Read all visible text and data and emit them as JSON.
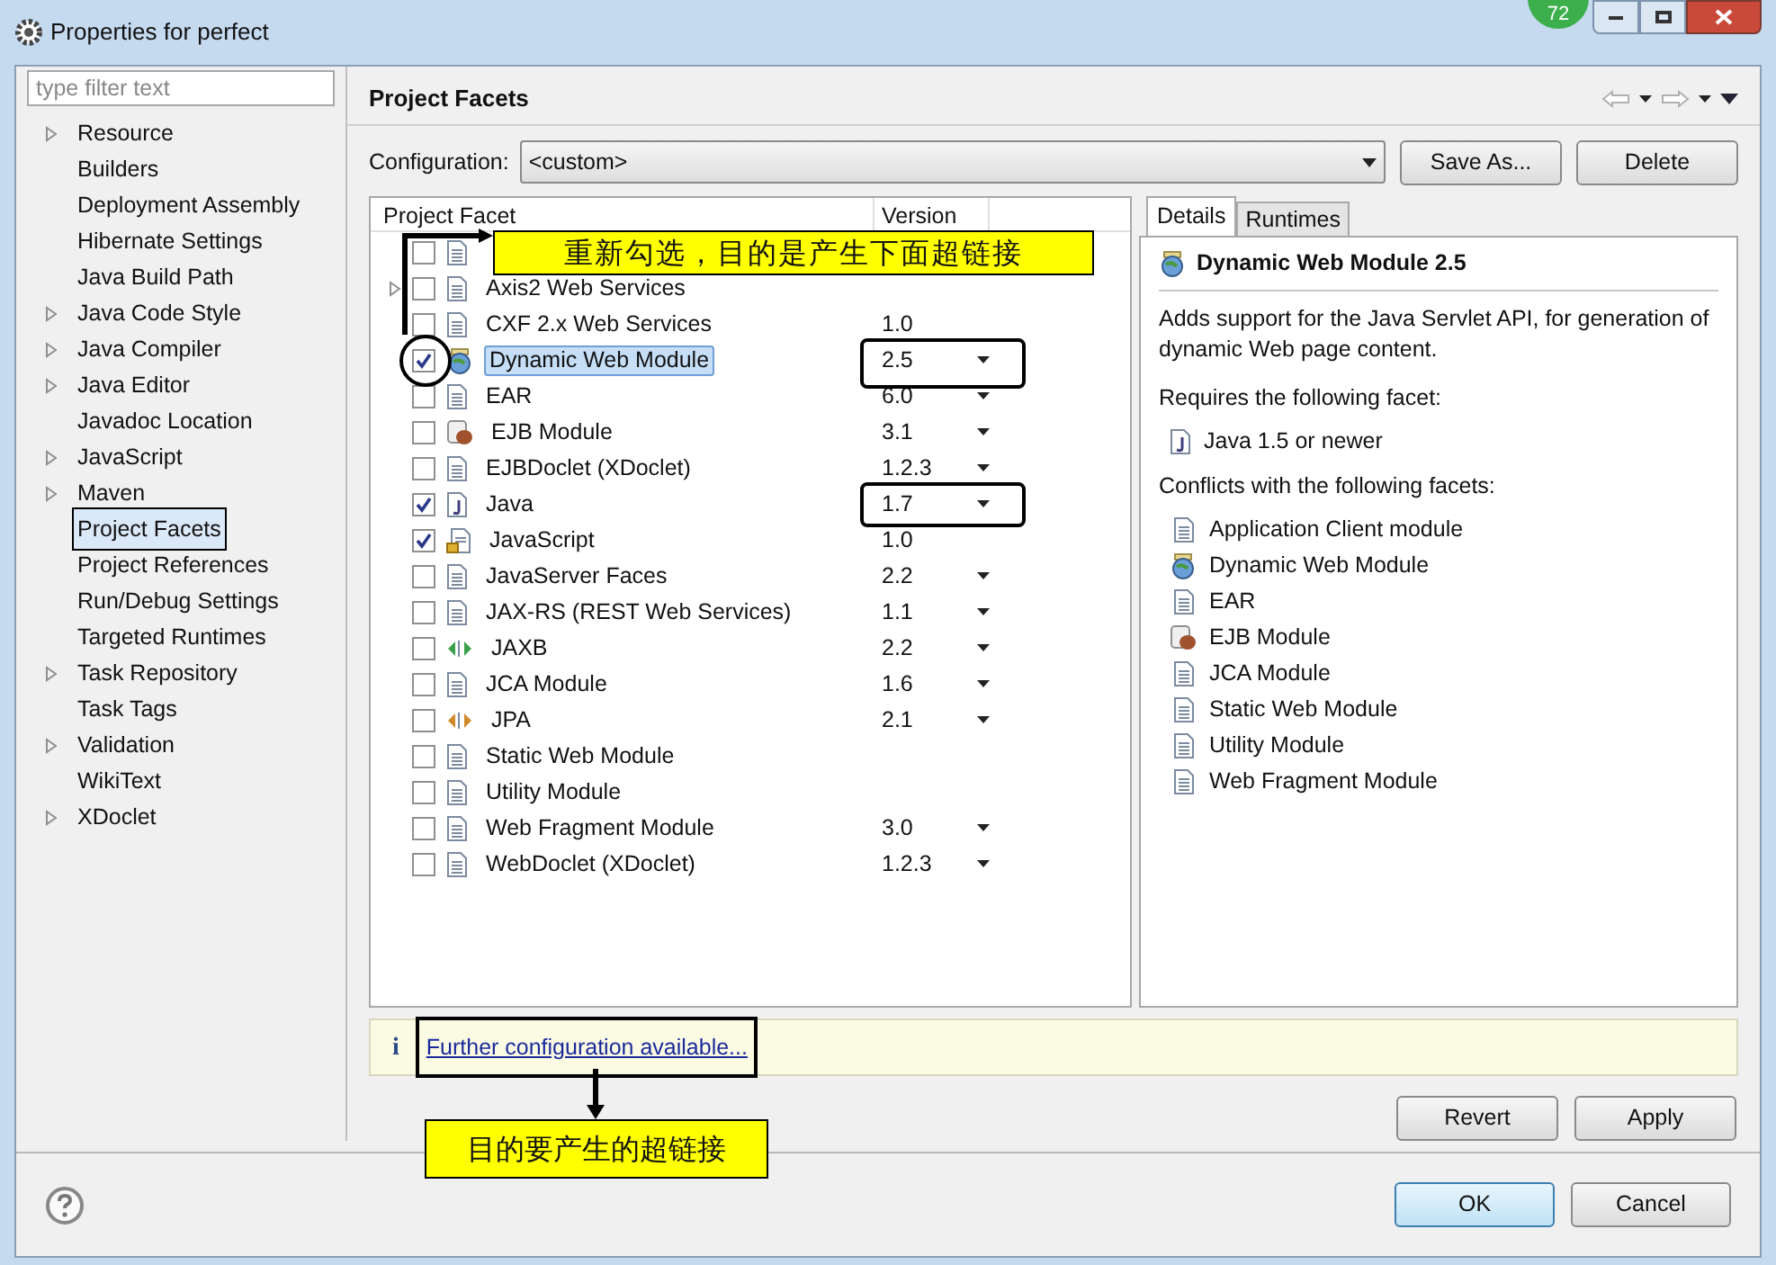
{
  "window": {
    "title": "Properties for perfect",
    "badge": "72"
  },
  "sidebar": {
    "filter": {
      "placeholder": "type filter text"
    },
    "items": [
      {
        "label": "Resource",
        "expandable": true,
        "selected": false
      },
      {
        "label": "Builders",
        "expandable": false,
        "selected": false
      },
      {
        "label": "Deployment Assembly",
        "expandable": false,
        "selected": false
      },
      {
        "label": "Hibernate Settings",
        "expandable": false,
        "selected": false
      },
      {
        "label": "Java Build Path",
        "expandable": false,
        "selected": false
      },
      {
        "label": "Java Code Style",
        "expandable": true,
        "selected": false
      },
      {
        "label": "Java Compiler",
        "expandable": true,
        "selected": false
      },
      {
        "label": "Java Editor",
        "expandable": true,
        "selected": false
      },
      {
        "label": "Javadoc Location",
        "expandable": false,
        "selected": false
      },
      {
        "label": "JavaScript",
        "expandable": true,
        "selected": false
      },
      {
        "label": "Maven",
        "expandable": true,
        "selected": false
      },
      {
        "label": "Project Facets",
        "expandable": false,
        "selected": true
      },
      {
        "label": "Project References",
        "expandable": false,
        "selected": false
      },
      {
        "label": "Run/Debug Settings",
        "expandable": false,
        "selected": false
      },
      {
        "label": "Targeted Runtimes",
        "expandable": false,
        "selected": false
      },
      {
        "label": "Task Repository",
        "expandable": true,
        "selected": false
      },
      {
        "label": "Task Tags",
        "expandable": false,
        "selected": false
      },
      {
        "label": "Validation",
        "expandable": true,
        "selected": false
      },
      {
        "label": "WikiText",
        "expandable": false,
        "selected": false
      },
      {
        "label": "XDoclet",
        "expandable": true,
        "selected": false
      }
    ]
  },
  "page": {
    "title": "Project Facets",
    "configuration": {
      "label": "Configuration:",
      "value": "<custom>"
    },
    "buttons": [
      "Save As...",
      "Delete"
    ]
  },
  "facets": {
    "columns": [
      "Project Facet",
      "Version"
    ],
    "rows": [
      {
        "kind": "document",
        "checked": false,
        "expandable": false,
        "selected": false
      },
      {
        "kind": "document",
        "name": "Axis2 Web Services",
        "checked": false,
        "expandable": true,
        "selected": false
      },
      {
        "kind": "document",
        "name": "CXF 2.x Web Services",
        "version": "1.0",
        "dropdown": false,
        "checked": false,
        "expandable": false,
        "selected": false
      },
      {
        "kind": "web",
        "name": "Dynamic Web Module",
        "version": "2.5",
        "dropdown": true,
        "checked": true,
        "expandable": false,
        "selected": true
      },
      {
        "kind": "document",
        "name": "EAR",
        "version": "6.0",
        "dropdown": true,
        "checked": false,
        "expandable": false,
        "selected": false
      },
      {
        "kind": "bean",
        "name": "EJB Module",
        "version": "3.1",
        "dropdown": true,
        "checked": false,
        "expandable": false,
        "selected": false
      },
      {
        "kind": "document",
        "name": "EJBDoclet (XDoclet)",
        "version": "1.2.3",
        "dropdown": true,
        "checked": false,
        "expandable": false,
        "selected": false
      },
      {
        "kind": "java",
        "name": "Java",
        "version": "1.7",
        "dropdown": true,
        "checked": true,
        "expandable": false,
        "selected": false
      },
      {
        "kind": "locked",
        "name": "JavaScript",
        "version": "1.0",
        "dropdown": false,
        "checked": true,
        "expandable": false,
        "selected": false
      },
      {
        "kind": "document",
        "name": "JavaServer Faces",
        "version": "2.2",
        "dropdown": true,
        "checked": false,
        "expandable": false,
        "selected": false
      },
      {
        "kind": "document",
        "name": "JAX-RS (REST Web Services)",
        "version": "1.1",
        "dropdown": true,
        "checked": false,
        "expandable": false,
        "selected": false
      },
      {
        "kind": "binding",
        "color": "#3aa04a",
        "name": "JAXB",
        "version": "2.2",
        "dropdown": true,
        "checked": false,
        "expandable": false,
        "selected": false
      },
      {
        "kind": "document",
        "name": "JCA Module",
        "version": "1.6",
        "dropdown": true,
        "checked": false,
        "expandable": false,
        "selected": false
      },
      {
        "kind": "binding",
        "color": "#d08a2a",
        "name": "JPA",
        "version": "2.1",
        "dropdown": true,
        "checked": false,
        "expandable": false,
        "selected": false
      },
      {
        "kind": "document",
        "name": "Static Web Module",
        "checked": false,
        "expandable": false,
        "selected": false
      },
      {
        "kind": "document",
        "name": "Utility Module",
        "checked": false,
        "expandable": false,
        "selected": false
      },
      {
        "kind": "document",
        "name": "Web Fragment Module",
        "version": "3.0",
        "dropdown": true,
        "checked": false,
        "expandable": false,
        "selected": false
      },
      {
        "kind": "document",
        "name": "WebDoclet (XDoclet)",
        "version": "1.2.3",
        "dropdown": true,
        "checked": false,
        "expandable": false,
        "selected": false
      }
    ]
  },
  "details": {
    "tabs": [
      {
        "label": "Details",
        "selected": true
      },
      {
        "label": "Runtimes",
        "selected": false
      }
    ],
    "title": "Dynamic Web Module 2.5",
    "description": "Adds support for the Java Servlet API, for generation of dynamic Web page content.",
    "requires_label": "Requires the following facet:",
    "requires": [
      {
        "kind": "java",
        "name": "Java 1.5 or newer"
      }
    ],
    "conflicts_label": "Conflicts with the following facets:",
    "conflicts": [
      {
        "kind": "document",
        "name": "Application Client module"
      },
      {
        "kind": "web",
        "name": "Dynamic Web Module"
      },
      {
        "kind": "document",
        "name": "EAR"
      },
      {
        "kind": "bean",
        "name": "EJB Module"
      },
      {
        "kind": "document",
        "name": "JCA Module"
      },
      {
        "kind": "document",
        "name": "Static Web Module"
      },
      {
        "kind": "document",
        "name": "Utility Module"
      },
      {
        "kind": "document",
        "name": "Web Fragment Module"
      }
    ]
  },
  "info": {
    "icon": "i",
    "link": "Further configuration available..."
  },
  "page_buttons": [
    "Revert",
    "Apply"
  ],
  "dialog_buttons": [
    {
      "label": "OK",
      "default": true
    },
    {
      "label": "Cancel",
      "default": false
    }
  ],
  "annotations": [
    {
      "text": "重新勾选，目的是产生下面超链接"
    },
    {
      "text": "目的要产生的超链接"
    }
  ]
}
